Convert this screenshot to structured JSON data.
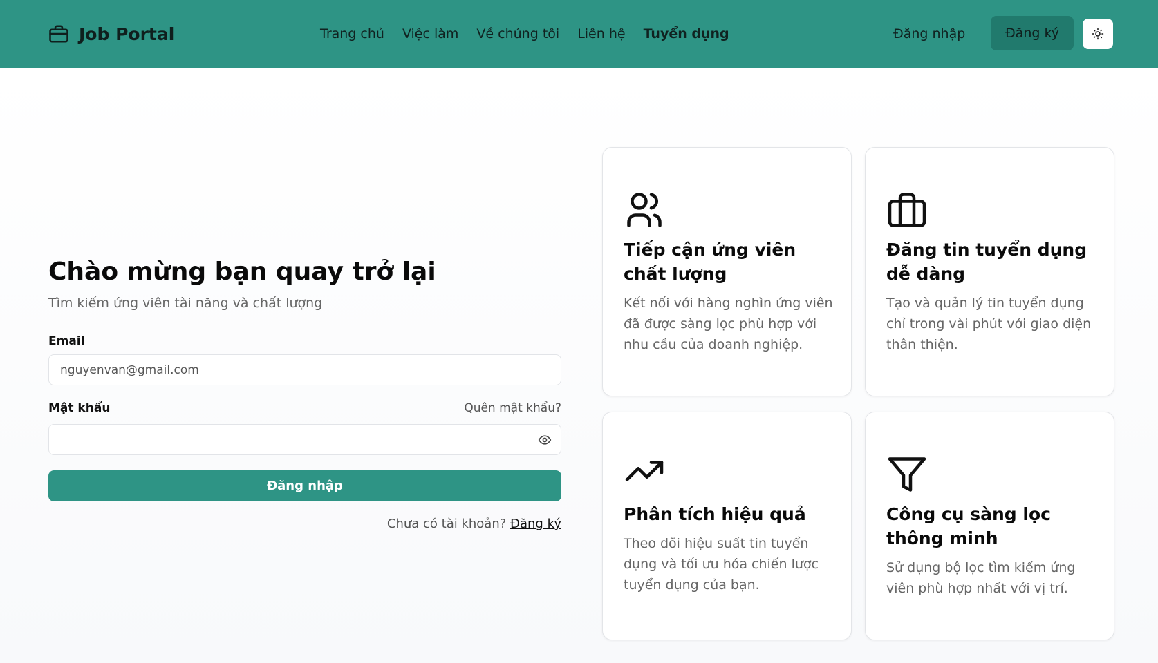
{
  "header": {
    "brand": "Job Portal",
    "nav": [
      "Trang chủ",
      "Việc làm",
      "Về chúng tôi",
      "Liên hệ",
      "Tuyển dụng"
    ],
    "active_nav": "Tuyển dụng",
    "login_label": "Đăng nhập",
    "register_label": "Đăng ký",
    "theme_icon": "sun-icon",
    "bg_color": "#2e9485"
  },
  "login": {
    "title": "Chào mừng bạn quay trở lại",
    "subtitle": "Tìm kiếm ứng viên tài năng và chất lượng",
    "email_label": "Email",
    "email_placeholder": "nguyenvan@gmail.com",
    "email_value": "",
    "password_label": "Mật khẩu",
    "password_value": "",
    "forgot_label": "Quên mật khẩu?",
    "submit_label": "Đăng nhập",
    "no_account_text": "Chưa có tài khoản?",
    "register_link": "Đăng ký",
    "accent_color": "#2e9485"
  },
  "features": [
    {
      "icon": "users-icon",
      "title": "Tiếp cận ứng viên chất lượng",
      "description": "Kết nối với hàng nghìn ứng viên đã được sàng lọc phù hợp với nhu cầu của doanh nghiệp."
    },
    {
      "icon": "briefcase-icon",
      "title": "Đăng tin tuyển dụng dễ dàng",
      "description": "Tạo và quản lý tin tuyển dụng chỉ trong vài phút với giao diện thân thiện."
    },
    {
      "icon": "trending-up-icon",
      "title": "Phân tích hiệu quả",
      "description": "Theo dõi hiệu suất tin tuyển dụng và tối ưu hóa chiến lược tuyển dụng của bạn."
    },
    {
      "icon": "filter-icon",
      "title": "Công cụ sàng lọc thông minh",
      "description": "Sử dụng bộ lọc tìm kiếm ứng viên phù hợp nhất với vị trí."
    }
  ]
}
